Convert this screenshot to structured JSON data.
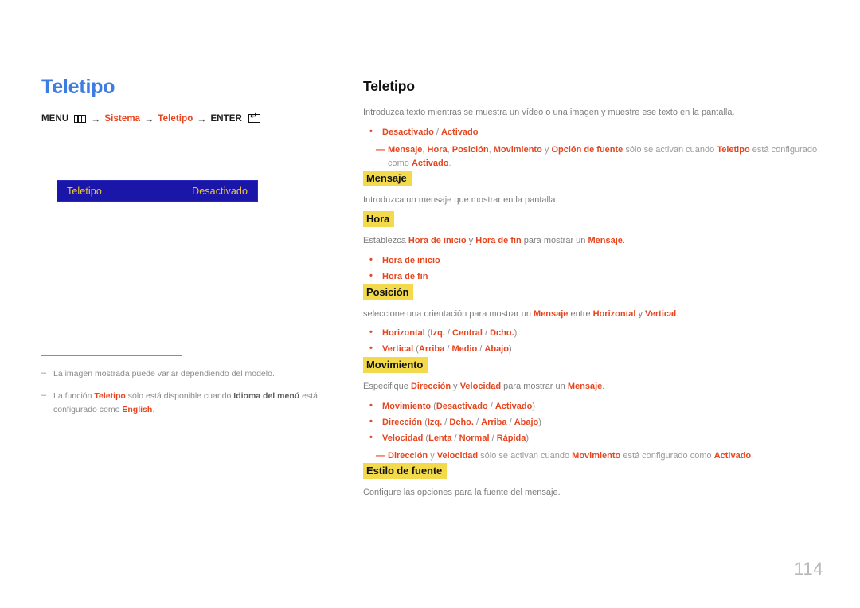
{
  "page_number": "114",
  "left": {
    "title": "Teletipo",
    "menu_path": {
      "menu_label": "MENU",
      "menu_icon": "menu-grid-icon",
      "arrow": "→",
      "step1": "Sistema",
      "step2": "Teletipo",
      "enter_label": "ENTER",
      "enter_icon": "enter-return-icon"
    },
    "osd": {
      "label": "Teletipo",
      "value": "Desactivado"
    },
    "notes": [
      {
        "dash": "–",
        "parts": [
          {
            "t": "La imagen mostrada puede variar dependiendo del modelo.",
            "s": "plain"
          }
        ]
      },
      {
        "dash": "–",
        "parts": [
          {
            "t": "La función ",
            "s": "plain"
          },
          {
            "t": "Teletipo",
            "s": "red"
          },
          {
            "t": " sólo está disponible cuando ",
            "s": "plain"
          },
          {
            "t": "Idioma del menú",
            "s": "dark"
          },
          {
            "t": " está configurado como ",
            "s": "plain"
          },
          {
            "t": "English",
            "s": "red"
          },
          {
            "t": ".",
            "s": "plain"
          }
        ]
      }
    ]
  },
  "right": {
    "title": "Teletipo",
    "intro": [
      {
        "t": "Introduzca texto mientras se muestra un vídeo o una imagen y muestre ese texto en la pantalla.",
        "s": "plain"
      }
    ],
    "intro_bullets": [
      {
        "parts": [
          {
            "t": "Desactivado",
            "s": "red"
          },
          {
            "t": " / ",
            "s": "paren"
          },
          {
            "t": "Activado",
            "s": "red"
          }
        ]
      }
    ],
    "intro_note": {
      "em": "—",
      "parts": [
        {
          "t": "Mensaje",
          "s": "red"
        },
        {
          "t": ", ",
          "s": "plain"
        },
        {
          "t": "Hora",
          "s": "red"
        },
        {
          "t": ", ",
          "s": "plain"
        },
        {
          "t": "Posición",
          "s": "red"
        },
        {
          "t": ", ",
          "s": "plain"
        },
        {
          "t": "Movimiento",
          "s": "red"
        },
        {
          "t": " y ",
          "s": "plain"
        },
        {
          "t": "Opción de fuente",
          "s": "red"
        },
        {
          "t": " sólo se activan cuando ",
          "s": "plain"
        },
        {
          "t": "Teletipo",
          "s": "red"
        },
        {
          "t": " está configurado como ",
          "s": "plain"
        },
        {
          "t": "Activado",
          "s": "red"
        },
        {
          "t": ".",
          "s": "plain"
        }
      ]
    },
    "sections": [
      {
        "heading": "Mensaje",
        "body": [
          {
            "t": "Introduzca un mensaje que mostrar en la pantalla.",
            "s": "plain"
          }
        ],
        "bullets": [],
        "note": null
      },
      {
        "heading": "Hora",
        "body": [
          {
            "t": "Establezca ",
            "s": "plain"
          },
          {
            "t": "Hora de inicio",
            "s": "red"
          },
          {
            "t": " y ",
            "s": "plain"
          },
          {
            "t": "Hora de fin",
            "s": "red"
          },
          {
            "t": " para mostrar un ",
            "s": "plain"
          },
          {
            "t": "Mensaje",
            "s": "red"
          },
          {
            "t": ".",
            "s": "plain"
          }
        ],
        "bullets": [
          {
            "parts": [
              {
                "t": "Hora de inicio",
                "s": "red"
              }
            ]
          },
          {
            "parts": [
              {
                "t": "Hora de fin",
                "s": "red"
              }
            ]
          }
        ],
        "note": null
      },
      {
        "heading": "Posición",
        "body": [
          {
            "t": "seleccione una orientación para mostrar un ",
            "s": "plain"
          },
          {
            "t": "Mensaje",
            "s": "red"
          },
          {
            "t": " entre ",
            "s": "plain"
          },
          {
            "t": "Horizontal",
            "s": "red"
          },
          {
            "t": " y ",
            "s": "plain"
          },
          {
            "t": "Vertical",
            "s": "red"
          },
          {
            "t": ".",
            "s": "plain"
          }
        ],
        "bullets": [
          {
            "parts": [
              {
                "t": "Horizontal",
                "s": "red"
              },
              {
                "t": " (",
                "s": "paren"
              },
              {
                "t": "Izq.",
                "s": "red"
              },
              {
                "t": " / ",
                "s": "paren"
              },
              {
                "t": "Central",
                "s": "red"
              },
              {
                "t": " / ",
                "s": "paren"
              },
              {
                "t": "Dcho.",
                "s": "red"
              },
              {
                "t": ")",
                "s": "paren"
              }
            ]
          },
          {
            "parts": [
              {
                "t": "Vertical",
                "s": "red"
              },
              {
                "t": " (",
                "s": "paren"
              },
              {
                "t": "Arriba",
                "s": "red"
              },
              {
                "t": " / ",
                "s": "paren"
              },
              {
                "t": "Medio",
                "s": "red"
              },
              {
                "t": " / ",
                "s": "paren"
              },
              {
                "t": "Abajo",
                "s": "red"
              },
              {
                "t": ")",
                "s": "paren"
              }
            ]
          }
        ],
        "note": null
      },
      {
        "heading": "Movimiento",
        "body": [
          {
            "t": "Especifique ",
            "s": "plain"
          },
          {
            "t": "Dirección",
            "s": "red"
          },
          {
            "t": " y ",
            "s": "plain"
          },
          {
            "t": "Velocidad",
            "s": "red"
          },
          {
            "t": " para mostrar un ",
            "s": "plain"
          },
          {
            "t": "Mensaje",
            "s": "red"
          },
          {
            "t": ".",
            "s": "plain"
          }
        ],
        "bullets": [
          {
            "parts": [
              {
                "t": "Movimiento",
                "s": "red"
              },
              {
                "t": " (",
                "s": "paren"
              },
              {
                "t": "Desactivado",
                "s": "red"
              },
              {
                "t": " / ",
                "s": "paren"
              },
              {
                "t": "Activado",
                "s": "red"
              },
              {
                "t": ")",
                "s": "paren"
              }
            ]
          },
          {
            "parts": [
              {
                "t": "Dirección",
                "s": "red"
              },
              {
                "t": " (",
                "s": "paren"
              },
              {
                "t": "Izq.",
                "s": "red"
              },
              {
                "t": " / ",
                "s": "paren"
              },
              {
                "t": "Dcho.",
                "s": "red"
              },
              {
                "t": " / ",
                "s": "paren"
              },
              {
                "t": "Arriba",
                "s": "red"
              },
              {
                "t": " / ",
                "s": "paren"
              },
              {
                "t": "Abajo",
                "s": "red"
              },
              {
                "t": ")",
                "s": "paren"
              }
            ]
          },
          {
            "parts": [
              {
                "t": "Velocidad",
                "s": "red"
              },
              {
                "t": " (",
                "s": "paren"
              },
              {
                "t": "Lenta",
                "s": "red"
              },
              {
                "t": " / ",
                "s": "paren"
              },
              {
                "t": "Normal",
                "s": "red"
              },
              {
                "t": " / ",
                "s": "paren"
              },
              {
                "t": "Rápida",
                "s": "red"
              },
              {
                "t": ")",
                "s": "paren"
              }
            ]
          }
        ],
        "note": {
          "em": "—",
          "parts": [
            {
              "t": "Dirección",
              "s": "red"
            },
            {
              "t": " y ",
              "s": "plain"
            },
            {
              "t": "Velocidad",
              "s": "red"
            },
            {
              "t": " sólo se activan cuando ",
              "s": "plain"
            },
            {
              "t": "Movimiento",
              "s": "red"
            },
            {
              "t": " está configurado como ",
              "s": "plain"
            },
            {
              "t": "Activado",
              "s": "red"
            },
            {
              "t": ".",
              "s": "plain"
            }
          ]
        }
      },
      {
        "heading": "Estilo de fuente",
        "body": [
          {
            "t": "Configure las opciones para la fuente del mensaje.",
            "s": "plain"
          }
        ],
        "bullets": [],
        "note": null
      }
    ]
  },
  "colors": {
    "accent_blue": "#3d7ce0",
    "accent_red": "#e8451f",
    "highlight_yellow": "#f2da4c",
    "osd_blue": "#1a17a8",
    "osd_gold": "#f2c43c",
    "body_gray": "#7d7d7d"
  }
}
